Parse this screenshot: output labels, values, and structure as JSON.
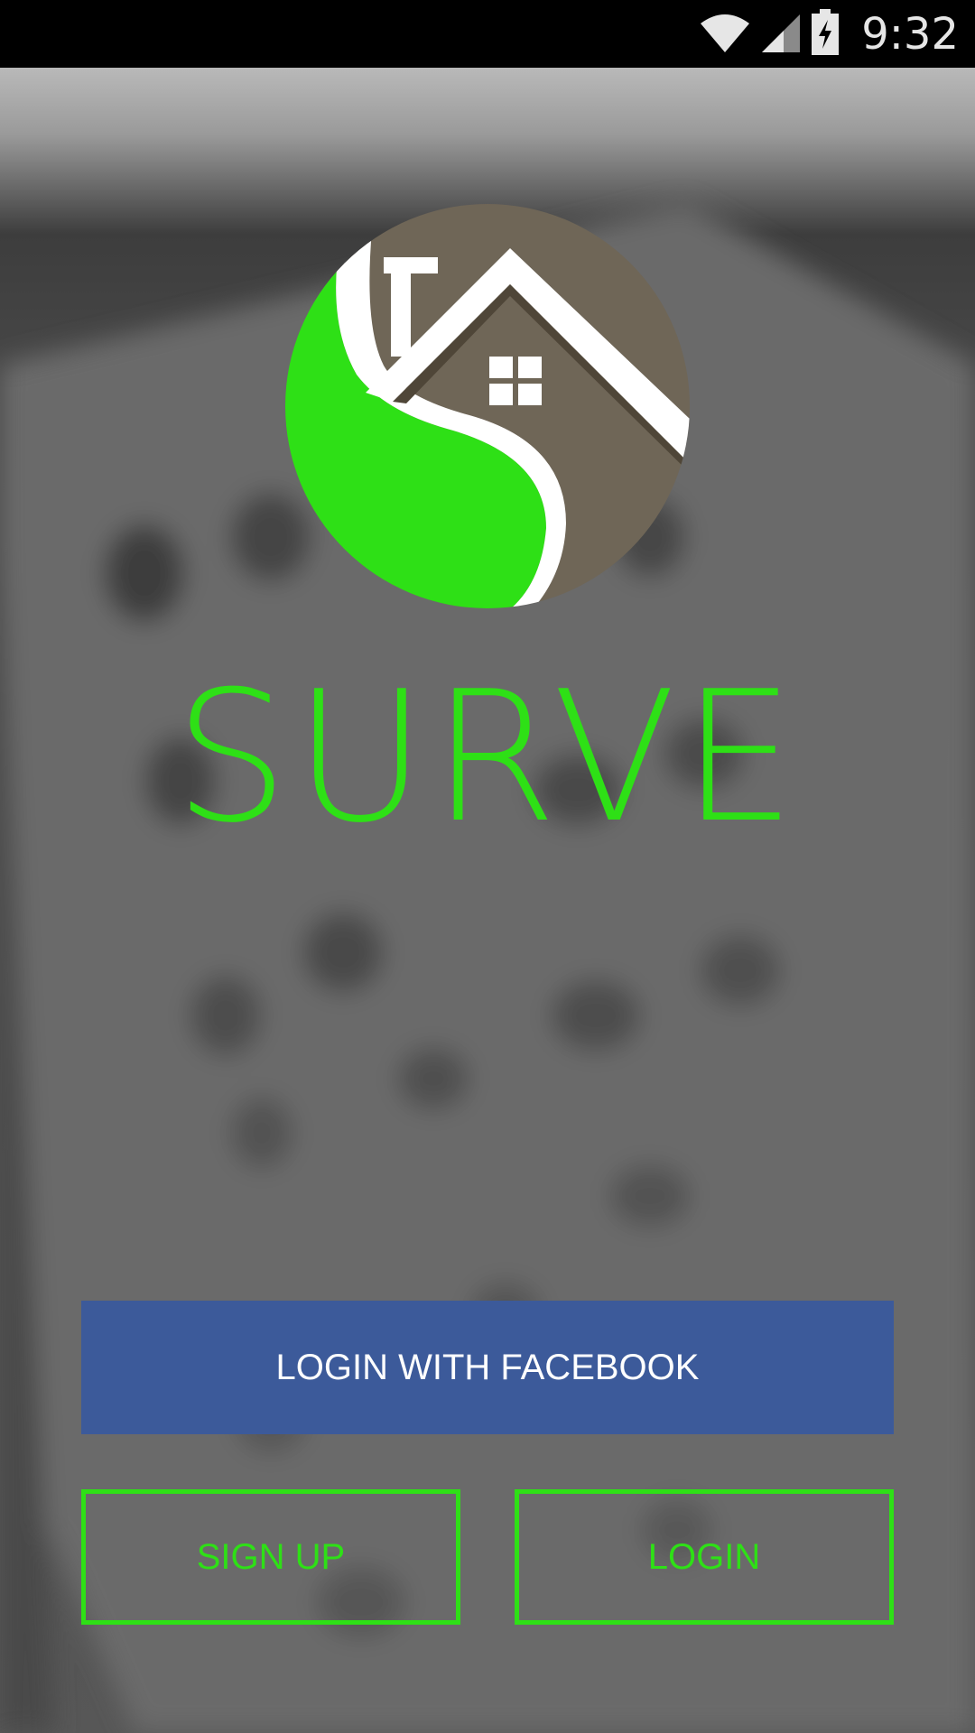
{
  "status_bar": {
    "time": "9:32",
    "icons": [
      "wifi-icon",
      "cellular-signal-icon",
      "battery-charging-icon"
    ]
  },
  "app": {
    "name": "SURVE"
  },
  "buttons": {
    "facebook_label": "LOGIN WITH FACEBOOK",
    "signup_label": "SIGN UP",
    "login_label": "LOGIN"
  },
  "colors": {
    "brand_green": "#2ee016",
    "facebook_blue": "#3c5a9a",
    "logo_brown": "#6f6657",
    "status_bar": "#000000"
  }
}
